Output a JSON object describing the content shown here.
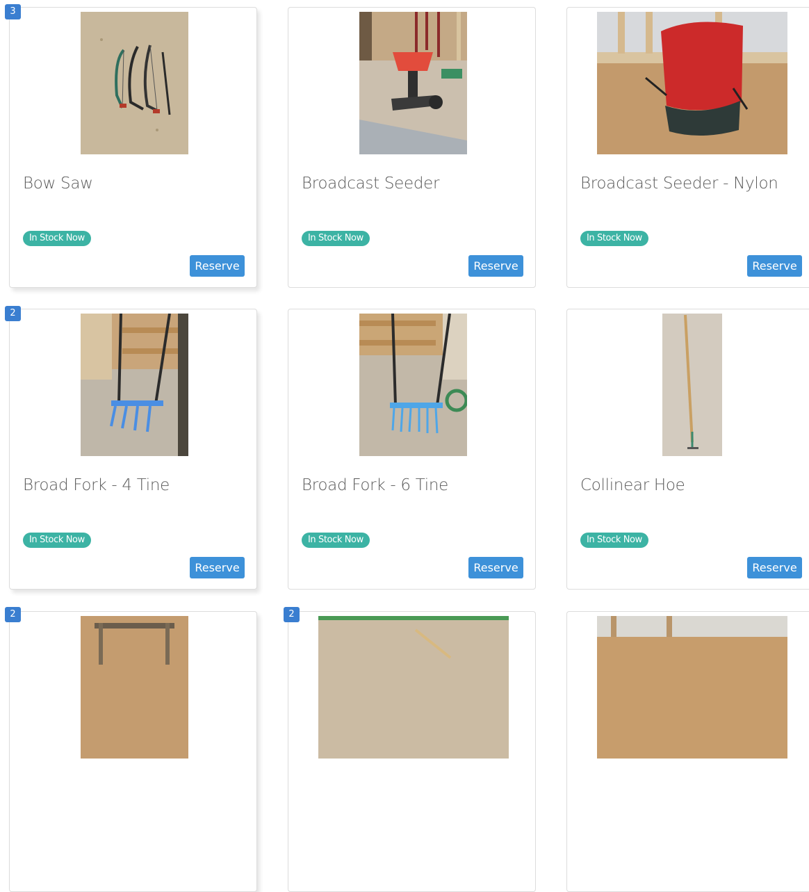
{
  "products": [
    {
      "name": "Bow Saw",
      "qty_badge": "3",
      "stock": "In Stock Now",
      "action": "Reserve",
      "image": "bow-saw-photo"
    },
    {
      "name": "Broadcast Seeder",
      "qty_badge": "",
      "stock": "In Stock Now",
      "action": "Reserve",
      "image": "broadcast-seeder-photo"
    },
    {
      "name": "Broadcast Seeder - Nylon",
      "qty_badge": "",
      "stock": "In Stock Now",
      "action": "Reserve",
      "image": "nylon-seeder-photo"
    },
    {
      "name": "Broad Fork - 4 Tine",
      "qty_badge": "2",
      "stock": "In Stock Now",
      "action": "Reserve",
      "image": "broad-fork-4-tine-photo"
    },
    {
      "name": "Broad Fork - 6 Tine",
      "qty_badge": "",
      "stock": "In Stock Now",
      "action": "Reserve",
      "image": "broad-fork-6-tine-photo"
    },
    {
      "name": "Collinear Hoe",
      "qty_badge": "",
      "stock": "In Stock Now",
      "action": "Reserve",
      "image": "collinear-hoe-photo"
    }
  ],
  "partial_row_badges": [
    "2",
    "2"
  ],
  "colors": {
    "badge": "#3a7ed0",
    "stock_pill": "#3cb3a4",
    "reserve_button": "#3d91d9",
    "title_text": "#5a5a5a"
  }
}
